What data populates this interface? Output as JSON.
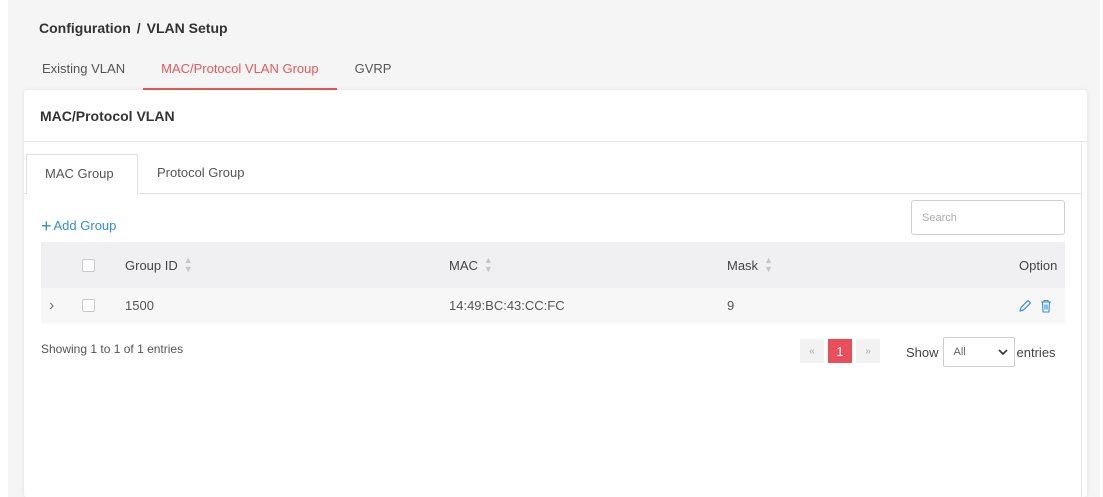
{
  "breadcrumb": {
    "parent": "Configuration",
    "separator": "/",
    "current": "VLAN Setup"
  },
  "top_tabs": [
    {
      "label": "Existing VLAN",
      "active": false
    },
    {
      "label": "MAC/Protocol VLAN Group",
      "active": true
    },
    {
      "label": "GVRP",
      "active": false
    }
  ],
  "card": {
    "title": "MAC/Protocol VLAN"
  },
  "sub_tabs": [
    {
      "label": "MAC Group",
      "active": true
    },
    {
      "label": "Protocol Group",
      "active": false
    }
  ],
  "toolbar": {
    "add_label": "Add Group",
    "search_placeholder": "Search"
  },
  "table": {
    "columns": {
      "group_id": "Group ID",
      "mac": "MAC",
      "mask": "Mask",
      "option": "Option"
    },
    "rows": [
      {
        "group_id": "1500",
        "mac": "14:49:BC:43:CC:FC",
        "mask": "9"
      }
    ]
  },
  "footer": {
    "info": "Showing 1 to 1 of 1 entries",
    "pager": {
      "prev": "«",
      "current": "1",
      "next": "»"
    },
    "show_label": "Show",
    "page_size": "All",
    "entries_label": "entries"
  },
  "colors": {
    "accent": "#e8585c",
    "link": "#2f8fd6",
    "pager_active": "#ea4e5a"
  },
  "icons": [
    "plus-icon",
    "sort-icon",
    "chevron-right-icon",
    "edit-icon",
    "delete-icon",
    "chevron-down-icon"
  ]
}
